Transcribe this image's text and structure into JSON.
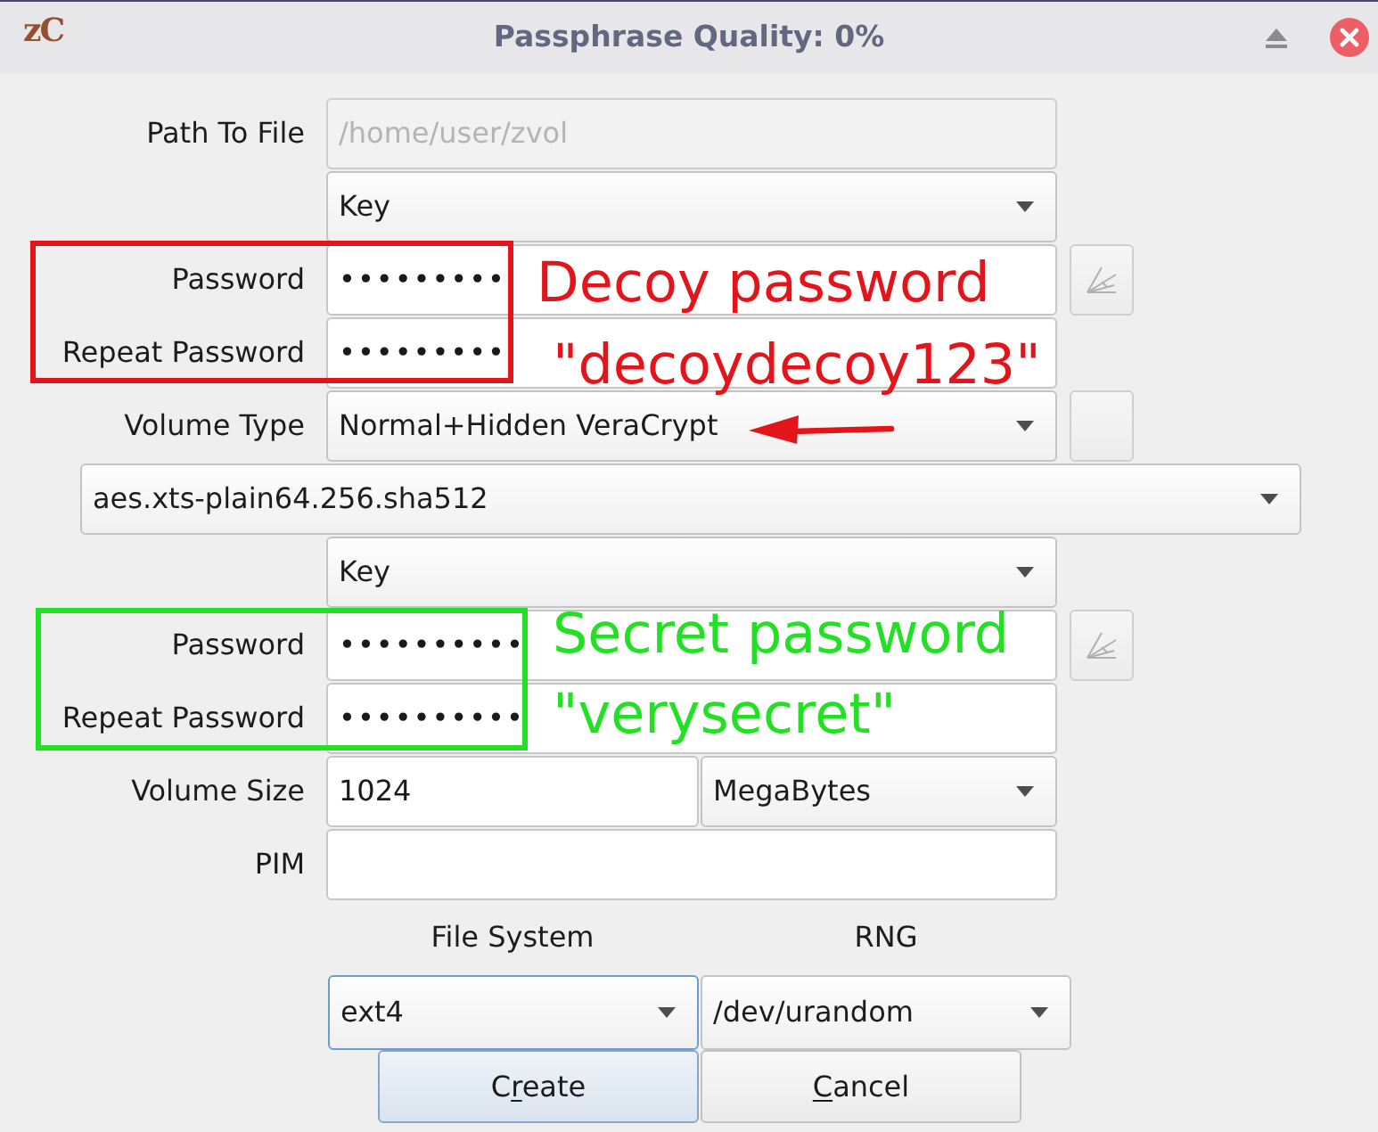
{
  "window": {
    "logo": "zC",
    "title": "Passphrase Quality: 0%"
  },
  "path_to_file": {
    "label": "Path To File",
    "value": "/home/user/zvol",
    "disabled": true
  },
  "decoy": {
    "key_source": "Key",
    "password": {
      "label": "Password",
      "value": "•••••••••"
    },
    "repeat_password": {
      "label": "Repeat Password",
      "value": "•••••••••"
    },
    "annotation": {
      "color": "#e3151a",
      "lines": [
        "Decoy password",
        "\"decoydecoy123\""
      ]
    }
  },
  "volume_type": {
    "label": "Volume Type",
    "value": "Normal+Hidden VeraCrypt",
    "arrow": {
      "color": "#e3151a"
    }
  },
  "cipher": {
    "value": "aes.xts-plain64.256.sha512"
  },
  "hidden": {
    "key_source": "Key",
    "password": {
      "label": "Password",
      "value": "••••••••••"
    },
    "repeat_password": {
      "label": "Repeat Password",
      "value": "••••••••••"
    },
    "annotation": {
      "color": "#24e024",
      "lines": [
        "Secret password",
        "\"verysecret\""
      ]
    }
  },
  "volume_size": {
    "label": "Volume Size",
    "value": "1024",
    "unit": "MegaBytes"
  },
  "pim": {
    "label": "PIM"
  },
  "file_system": {
    "label": "File System",
    "value": "ext4",
    "focused": true
  },
  "rng": {
    "label": "RNG",
    "value": "/dev/urandom",
    "focused": false
  },
  "buttons": [
    {
      "label_runs": [
        {
          "text": "C",
          "underlined": false
        },
        {
          "text": "r",
          "underlined": true
        },
        {
          "text": "eate",
          "underlined": false
        }
      ],
      "default": true
    },
    {
      "label_runs": [
        {
          "text": "C",
          "underlined": true
        },
        {
          "text": "ancel",
          "underlined": false
        }
      ],
      "default": false
    }
  ]
}
